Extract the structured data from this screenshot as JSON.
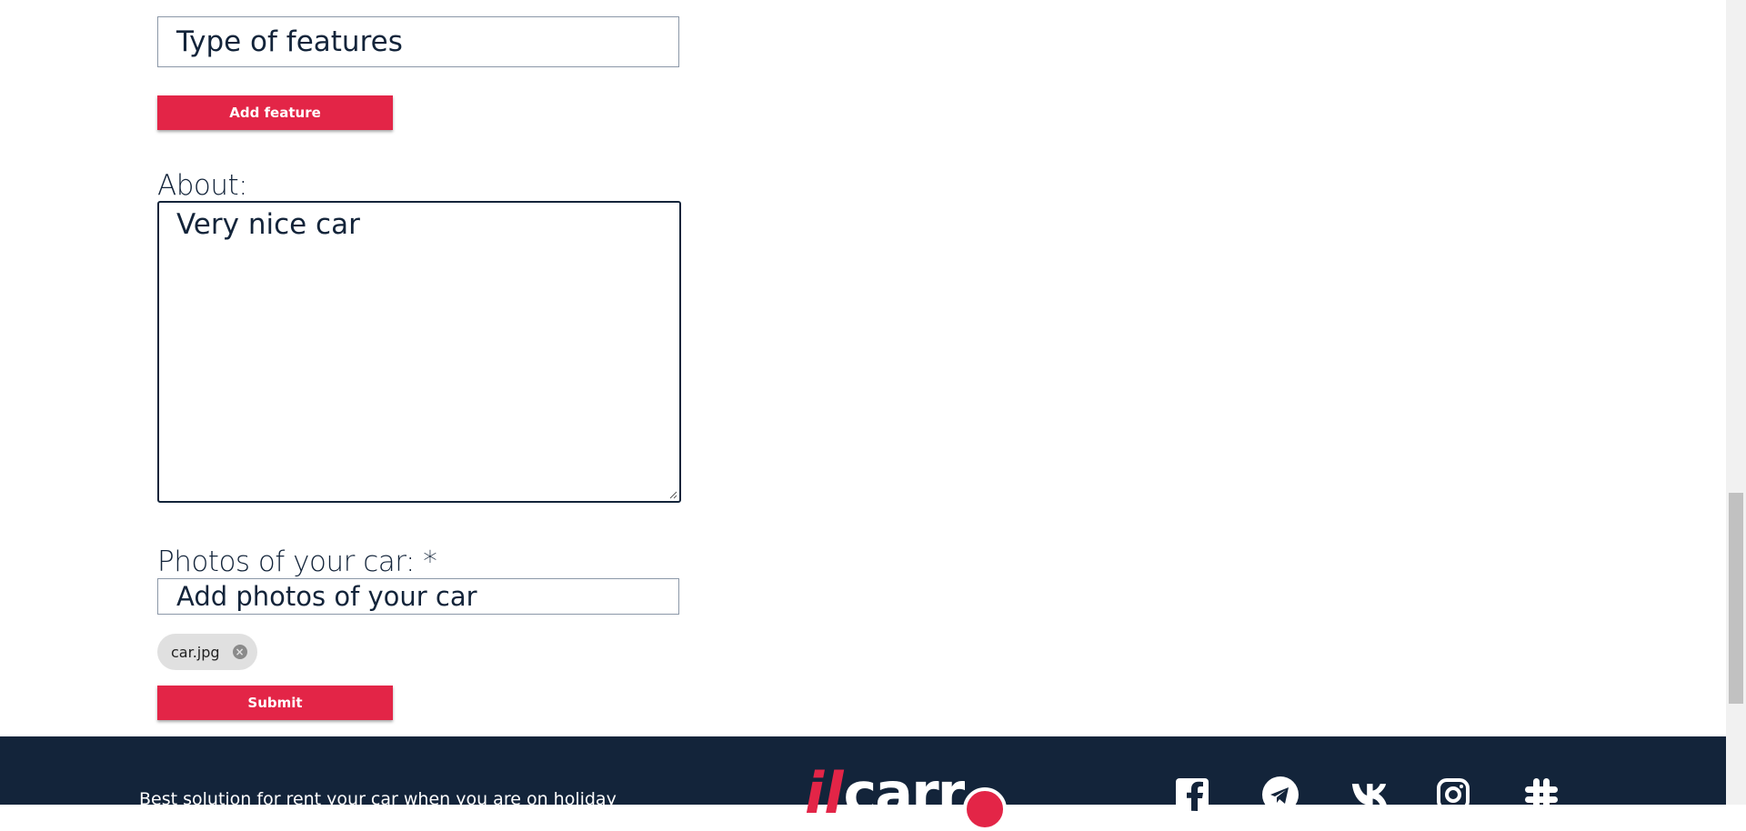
{
  "form": {
    "features_placeholder": "Type of features",
    "add_feature_label": "Add feature",
    "about_label": "About:",
    "about_value": "Very nice car",
    "photos_label": "Photos of your car: *",
    "photos_placeholder": "Add photos of your car",
    "uploaded_files": [
      {
        "name": "car.jpg"
      }
    ],
    "submit_label": "Submit"
  },
  "footer": {
    "tagline": "Best solution for rent your car when you are on holiday",
    "logo": {
      "prefix": "il",
      "word": "carr"
    },
    "social_icons": [
      "facebook-icon",
      "telegram-icon",
      "vk-icon",
      "instagram-icon",
      "slack-icon"
    ]
  },
  "colors": {
    "accent": "#e32547",
    "footer_bg": "#13243a",
    "text": "#13243a",
    "chip_bg": "#e0e0e0"
  }
}
